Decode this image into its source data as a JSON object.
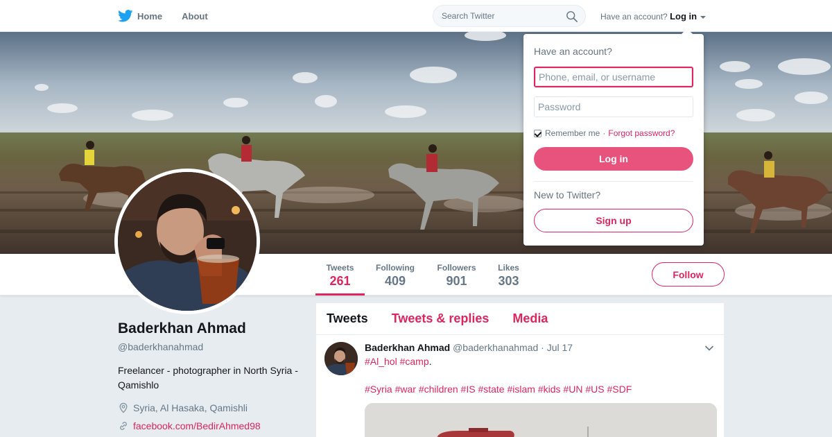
{
  "nav": {
    "home_label": "Home",
    "about_label": "About",
    "search_placeholder": "Search Twitter",
    "account_prompt": "Have an account?",
    "login_label": "Log in"
  },
  "login_dropdown": {
    "title": "Have an account?",
    "username_placeholder": "Phone, email, or username",
    "password_placeholder": "Password",
    "remember_label": "Remember me",
    "separator": "·",
    "forgot_label": "Forgot password?",
    "login_button": "Log in",
    "new_prompt": "New to Twitter?",
    "signup_button": "Sign up"
  },
  "stats": [
    {
      "label": "Tweets",
      "value": "261"
    },
    {
      "label": "Following",
      "value": "409"
    },
    {
      "label": "Followers",
      "value": "901"
    },
    {
      "label": "Likes",
      "value": "303"
    }
  ],
  "follow_label": "Follow",
  "profile": {
    "name": "Baderkhan Ahmad",
    "handle": "@baderkhanahmad",
    "bio": "Freelancer - photographer in North Syria - Qamishlo",
    "location": "Syria, Al Hasaka, Qamishli",
    "website": "facebook.com/BedirAhmed98"
  },
  "timeline": {
    "tabs": [
      "Tweets",
      "Tweets & replies",
      "Media"
    ]
  },
  "tweet": {
    "name": "Baderkhan Ahmad",
    "handle": "@baderkhanahmad",
    "date": "· Jul 17",
    "line1_tags": [
      "#Al_hol",
      "#camp"
    ],
    "line1_end": ".",
    "line2_tags": [
      "#Syria",
      "#war",
      "#children",
      "#IS",
      "#state",
      "#islam",
      "#kids",
      "#UN",
      "#US",
      "#SDF"
    ]
  },
  "colors": {
    "accent": "#e0245e",
    "login_button": "#e8537e",
    "muted": "#657786",
    "background": "#e6ecf0"
  },
  "icons": {
    "logo": "twitter-bird-icon",
    "search": "search-icon",
    "location": "location-pin-icon",
    "link": "link-icon",
    "tweet_menu": "chevron-down-icon"
  }
}
